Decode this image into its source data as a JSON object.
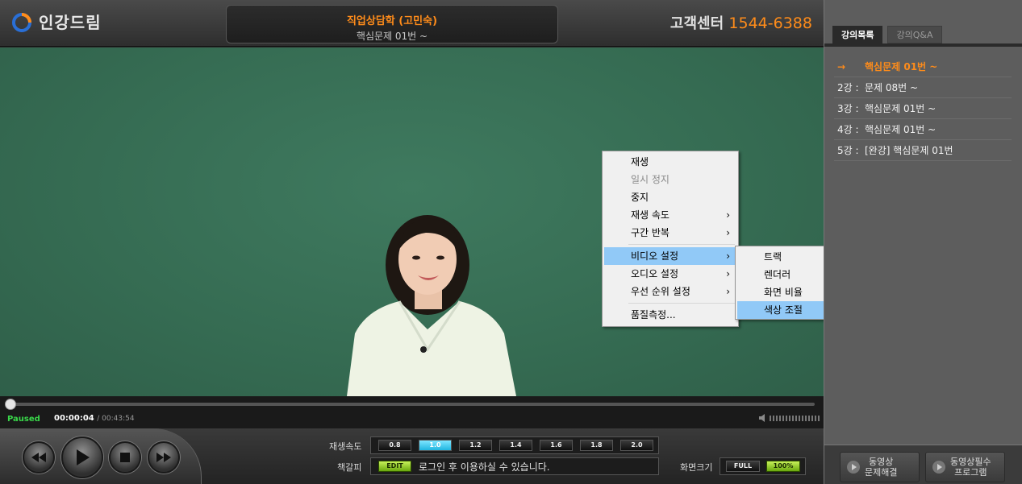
{
  "header": {
    "logo_text": "인강드림",
    "title_main": "직업상담학 (고민숙)",
    "title_sub": "핵심문제 01번 ~",
    "cs_label": "고객센터",
    "cs_number": "1544-6388"
  },
  "context_menu": {
    "items": [
      {
        "label": "재생",
        "disabled": false,
        "submenu": false
      },
      {
        "label": "일시 정지",
        "disabled": true,
        "submenu": false
      },
      {
        "label": "중지",
        "disabled": false,
        "submenu": false
      },
      {
        "label": "재생 속도",
        "disabled": false,
        "submenu": true
      },
      {
        "label": "구간 반복",
        "disabled": false,
        "submenu": true
      },
      {
        "label": "비디오 설정",
        "disabled": false,
        "submenu": true,
        "highlighted": true
      },
      {
        "label": "오디오 설정",
        "disabled": false,
        "submenu": true
      },
      {
        "label": "우선 순위 설정",
        "disabled": false,
        "submenu": true
      },
      {
        "label": "품질측정...",
        "disabled": false,
        "submenu": false
      }
    ],
    "arrow": "›"
  },
  "video_submenu": {
    "items": [
      {
        "label": "트랙",
        "submenu": true
      },
      {
        "label": "렌더러",
        "submenu": true
      },
      {
        "label": "화면 비율",
        "submenu": true
      },
      {
        "label": "색상 조절",
        "submenu": false,
        "highlighted": true
      }
    ]
  },
  "player": {
    "status": "Paused",
    "current_time": "00:00:04",
    "duration": "/ 00:43:54",
    "progress": 0.0015
  },
  "controls": {
    "speed_label": "재생속도",
    "speeds": [
      "0.8",
      "1.0",
      "1.2",
      "1.4",
      "1.6",
      "1.8",
      "2.0"
    ],
    "speed_selected": "1.0",
    "bookmark_label": "책갈피",
    "edit_label": "EDIT",
    "bookmark_text": "로그인 후 이용하실 수 있습니다.",
    "screen_size_label": "화면크기",
    "full_label": "FULL",
    "pct_label": "100%"
  },
  "sidebar": {
    "tabs": [
      "강의목록",
      "강의Q&A"
    ],
    "active_tab": "강의목록",
    "lectures": [
      {
        "no": "→",
        "title": "핵심문제 01번 ~",
        "current": true
      },
      {
        "no": "2강 :",
        "title": "문제 08번 ~",
        "current": false
      },
      {
        "no": "3강 :",
        "title": "핵심문제 01번 ~",
        "current": false
      },
      {
        "no": "4강 :",
        "title": "핵심문제 01번 ~",
        "current": false
      },
      {
        "no": "5강 :",
        "title": "[완강] 핵심문제 01번",
        "current": false
      }
    ],
    "btn1": [
      "동영상",
      "문제해결"
    ],
    "btn2": [
      "동영상필수",
      "프로그램"
    ]
  },
  "colors": {
    "accent": "#ff8c1a",
    "status_green": "#39d84a",
    "menu_highlight": "#91c9f7"
  }
}
